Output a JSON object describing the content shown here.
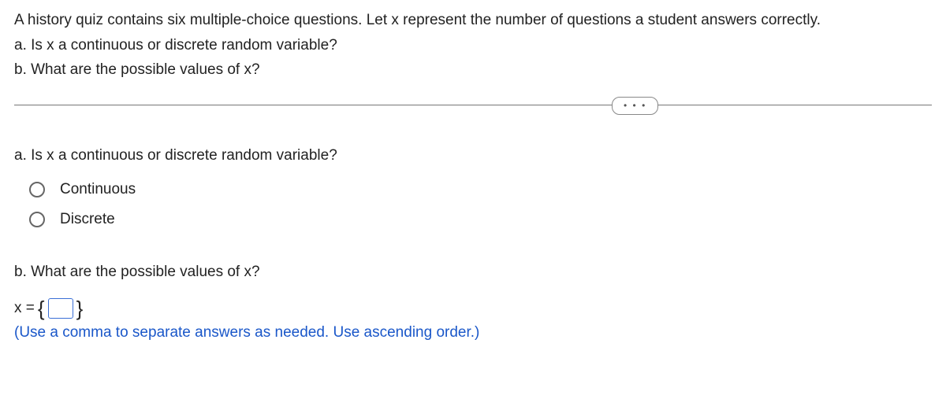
{
  "intro": {
    "line1": "A history quiz contains six multiple-choice questions. Let x represent the number of questions a student answers correctly.",
    "line2": "a. Is x a continuous or discrete random variable?",
    "line3": "b. What are the possible values of x?"
  },
  "divider": {
    "pill_label": "• • •"
  },
  "partA": {
    "prompt": "a. Is x a continuous or discrete random variable?",
    "options": [
      {
        "label": "Continuous"
      },
      {
        "label": "Discrete"
      }
    ]
  },
  "partB": {
    "prompt": "b. What are the possible values of x?",
    "prefix": "x =",
    "input_value": "",
    "hint": "(Use a comma to separate answers as needed. Use ascending order.)"
  }
}
